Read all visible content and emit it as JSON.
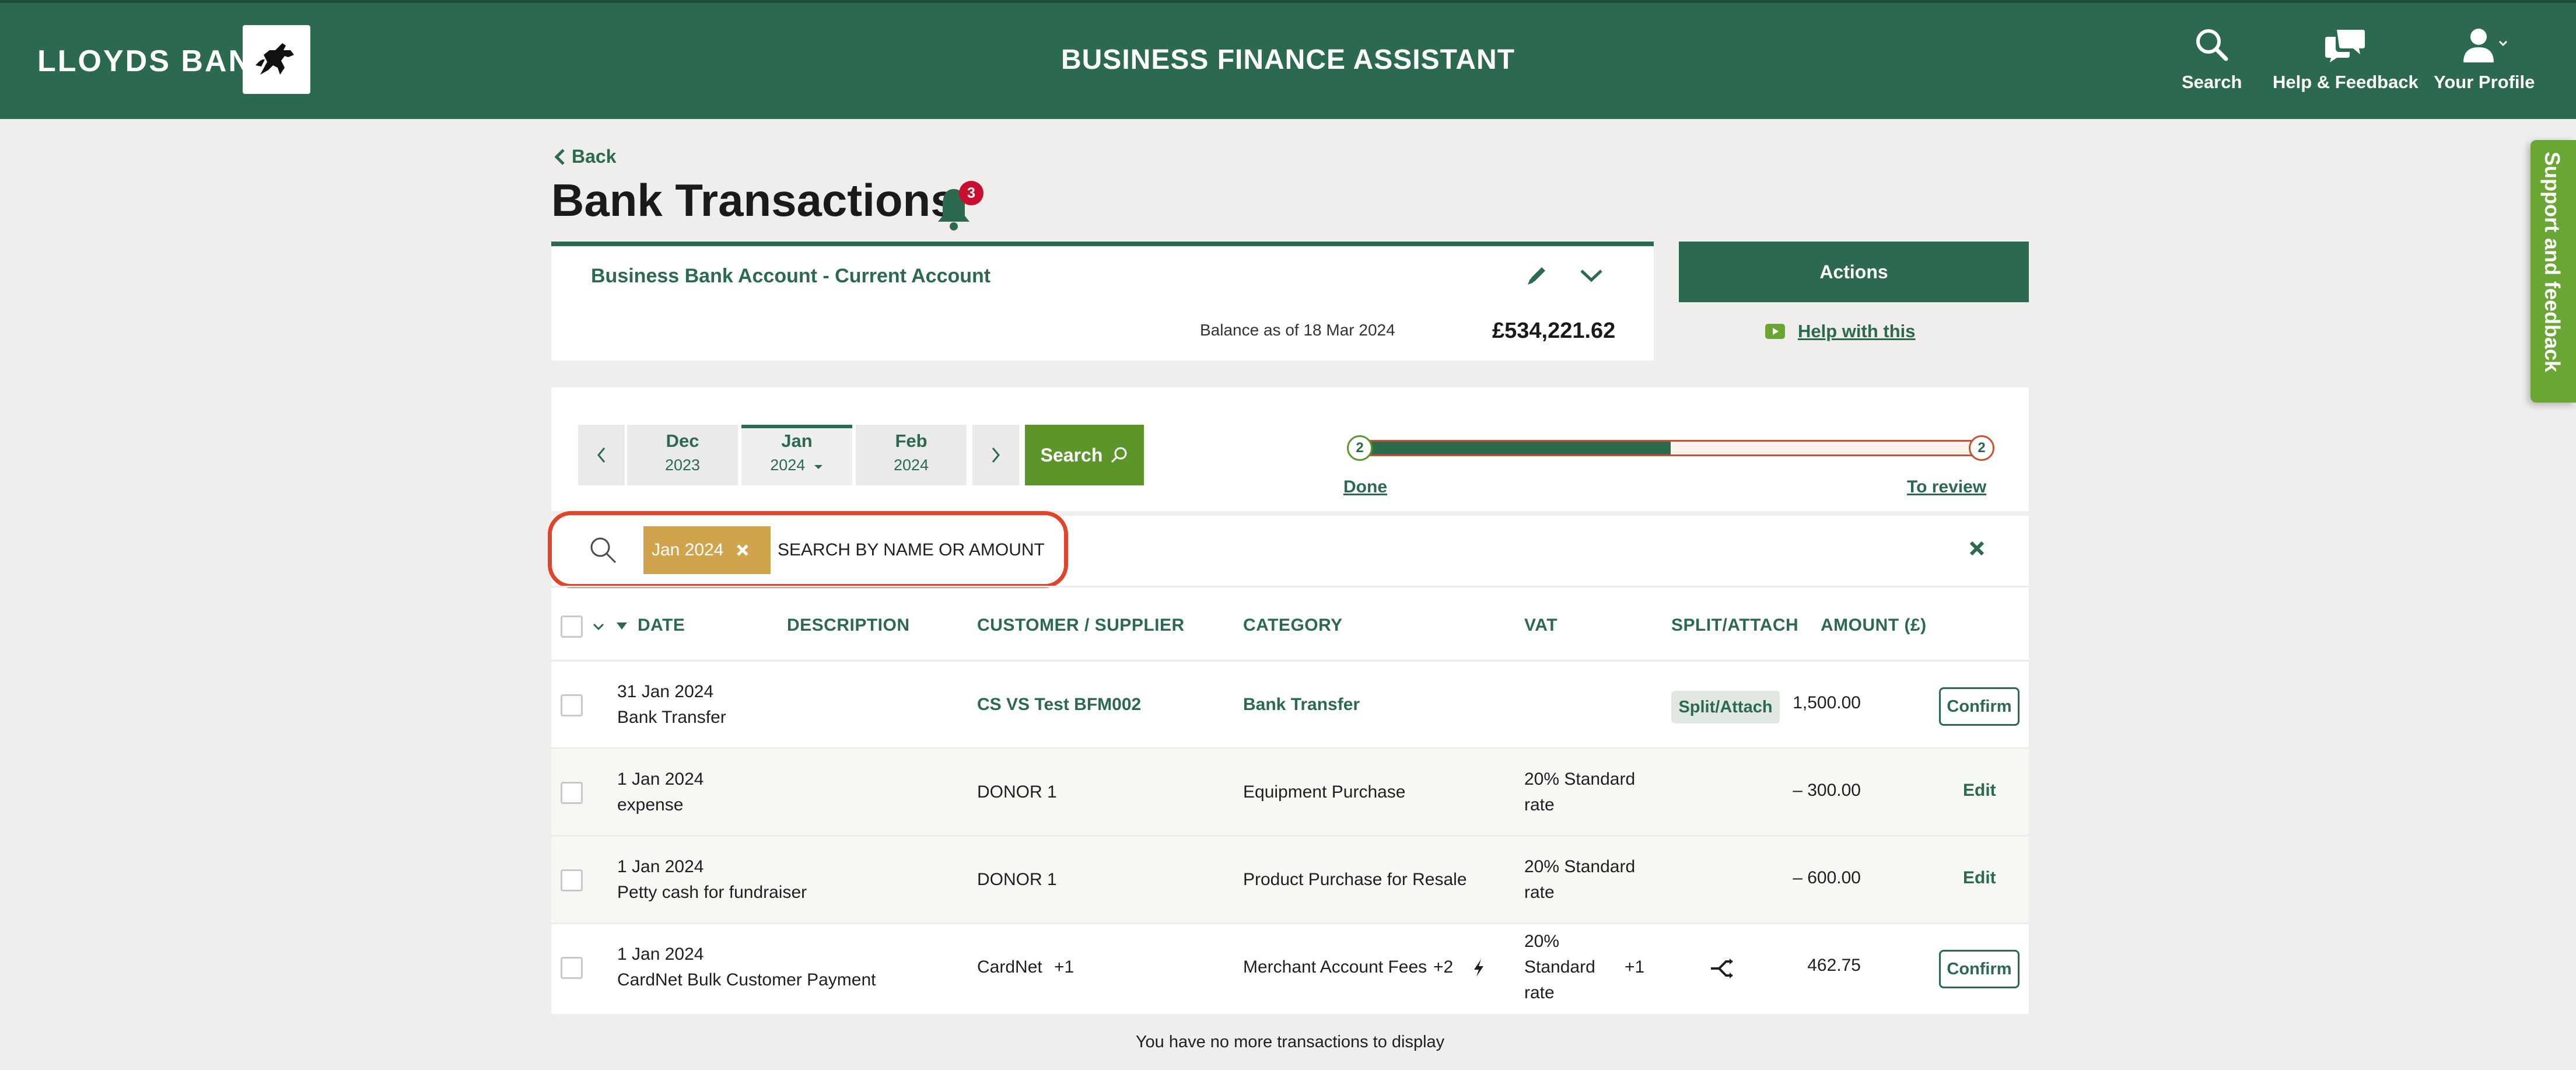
{
  "header": {
    "brand": "LLOYDS BANK",
    "title": "BUSINESS FINANCE ASSISTANT",
    "search_label": "Search",
    "help_label": "Help & Feedback",
    "profile_label": "Your Profile"
  },
  "side_tab": "Support and feedback",
  "back_label": "Back",
  "page_title": "Bank Transactions",
  "notification_count": "3",
  "account": {
    "name": "Business Bank Account - Current Account",
    "balance_label": "Balance as of 18 Mar 2024",
    "balance_value": "£534,221.62"
  },
  "actions_label": "Actions",
  "help_with_this": "Help with this",
  "months": [
    {
      "month": "Dec",
      "year": "2023"
    },
    {
      "month": "Jan",
      "year": "2024"
    },
    {
      "month": "Feb",
      "year": "2024"
    }
  ],
  "search_button": "Search",
  "progress": {
    "done_count": "2",
    "review_count": "2",
    "done_label": "Done",
    "review_label": "To review",
    "done_fraction": 0.5
  },
  "filter": {
    "chip_label": "Jan 2024",
    "placeholder": "SEARCH BY NAME OR AMOUNT"
  },
  "columns": {
    "date": "DATE",
    "description": "DESCRIPTION",
    "customer": "CUSTOMER / SUPPLIER",
    "category": "CATEGORY",
    "vat": "VAT",
    "split": "SPLIT/ATTACH",
    "amount": "AMOUNT (£)"
  },
  "rows": [
    {
      "date": "31 Jan 2024",
      "desc": "Bank Transfer",
      "customer": "CS VS Test BFM002",
      "category": "Bank Transfer",
      "vat": "",
      "split": "Split/Attach",
      "amount": "1,500.00",
      "action": "Confirm"
    },
    {
      "date": "1 Jan 2024",
      "desc": "expense",
      "customer": "DONOR 1",
      "category": "Equipment Purchase",
      "vat_line1": "20% Standard",
      "vat_line2": "rate",
      "amount": "– 300.00",
      "action": "Edit"
    },
    {
      "date": "1 Jan 2024",
      "desc": "Petty cash for fundraiser",
      "customer": "DONOR 1",
      "category": "Product Purchase for Resale",
      "vat_line1": "20% Standard",
      "vat_line2": "rate",
      "amount": "– 600.00",
      "action": "Edit"
    },
    {
      "date": "1 Jan 2024",
      "desc": "CardNet Bulk Customer Payment",
      "customer": "CardNet",
      "customer_extra": "+1",
      "category": "Merchant Account Fees",
      "category_extra": "+2",
      "vat_line1": "20%",
      "vat_line2": "Standard",
      "vat_line3": "rate",
      "vat_extra": "+1",
      "amount": "462.75",
      "action": "Confirm"
    }
  ],
  "footer_message": "You have no more transactions to display"
}
